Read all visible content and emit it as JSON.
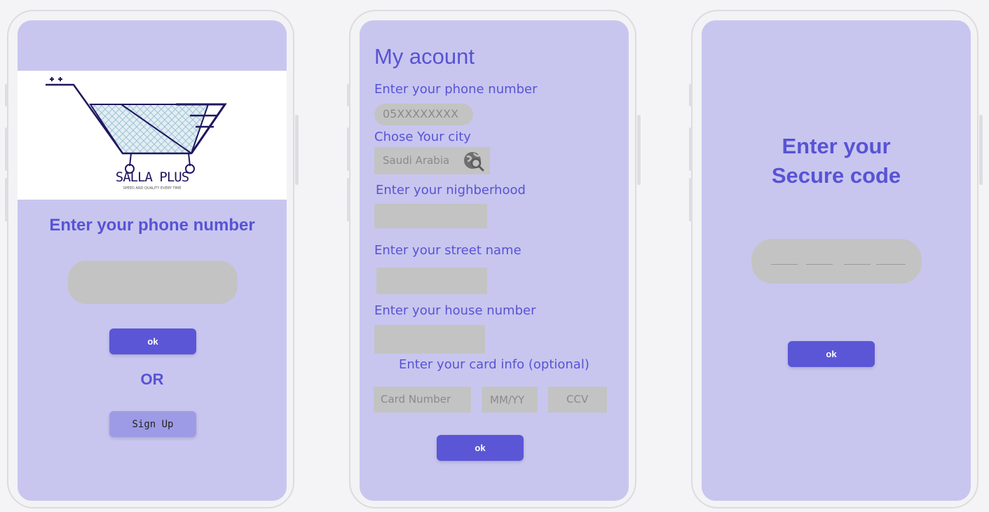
{
  "colors": {
    "accent": "#5a56d6",
    "screen_bg": "#c8c6ef",
    "input_bg": "#c3c3c3",
    "secondary_button": "#9e9be6"
  },
  "login": {
    "logo": {
      "brand": "SALLA PLUS",
      "tagline": "SPEED AND QUALITY EVERY TIME"
    },
    "prompt": "Enter your phone number",
    "ok_label": "ok",
    "or_label": "OR",
    "signup_label": "Sign Up"
  },
  "account": {
    "title": "My acount",
    "phone_label": "Enter your phone number",
    "phone_placeholder": "05XXXXXXXX",
    "city_label": "Chose Your city",
    "city_value": "Saudi Arabia",
    "neighborhood_label": "Enter your nighberhood",
    "street_label": "Enter your street name",
    "house_label": "Enter your house number",
    "card_label": "Enter your card info (optional)",
    "card_number_placeholder": "Card Number",
    "expiry_placeholder": "MM/YY",
    "ccv_placeholder": "CCV",
    "ok_label": "ok"
  },
  "secure": {
    "title_line1": "Enter your",
    "title_line2": "Secure code",
    "ok_label": "ok"
  },
  "icons": {
    "city_search": "globe-search-icon",
    "cart": "shopping-cart-icon"
  }
}
